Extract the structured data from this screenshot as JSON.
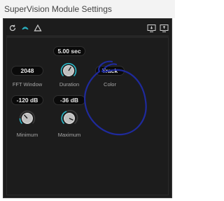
{
  "window": {
    "title": "SuperVision Module Settings"
  },
  "toolbar": {
    "left_icons": [
      "reset-icon",
      "link-icon",
      "triangle-icon"
    ],
    "right_icons": [
      "monitor-down-icon",
      "monitor-up-icon"
    ]
  },
  "controls": {
    "fft_window": {
      "value": "2048",
      "label": "FFT Window"
    },
    "duration": {
      "value": "5.00 sec",
      "label": "Duration"
    },
    "color": {
      "value": "Track",
      "label": "Color"
    },
    "minimum": {
      "value": "-120 dB",
      "label": "Minimum"
    },
    "maximum": {
      "value": "-36 dB",
      "label": "Maximum"
    }
  },
  "colors": {
    "panel_bg": "#1c1c1c",
    "knob_accent": "#2bb8c8",
    "scribble": "#1f2a9c"
  }
}
